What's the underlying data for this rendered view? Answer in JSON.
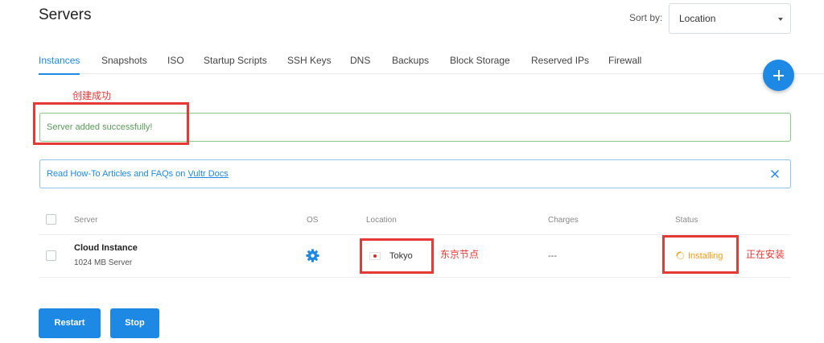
{
  "header": {
    "title": "Servers",
    "sort_label": "Sort by:",
    "sort_value": "Location"
  },
  "tabs": [
    {
      "label": "Instances",
      "active": true
    },
    {
      "label": "Snapshots"
    },
    {
      "label": "ISO"
    },
    {
      "label": "Startup Scripts"
    },
    {
      "label": "SSH Keys"
    },
    {
      "label": "DNS"
    },
    {
      "label": "Backups"
    },
    {
      "label": "Block Storage"
    },
    {
      "label": "Reserved IPs"
    },
    {
      "label": "Firewall"
    }
  ],
  "add_button": {
    "icon": "plus-icon"
  },
  "annotations": {
    "created": "创建成功",
    "tokyo_node": "东京节点",
    "installing": "正在安装"
  },
  "alerts": {
    "success": "Server added successfully!",
    "info_prefix": "Read How-To Articles and FAQs on ",
    "info_link": "Vultr Docs"
  },
  "table": {
    "columns": {
      "server": "Server",
      "os": "OS",
      "location": "Location",
      "charges": "Charges",
      "status": "Status"
    },
    "rows": [
      {
        "name": "Cloud Instance",
        "plan": "1024 MB Server",
        "os_icon": "gear-icon",
        "location": "Tokyo",
        "charges": "---",
        "status": "Installing"
      }
    ]
  },
  "actions": {
    "restart": "Restart",
    "stop": "Stop"
  },
  "colors": {
    "accent": "#1e88e5",
    "success": "#8bc98b",
    "annotation": "#e53935",
    "status_installing": "#f39c12"
  }
}
